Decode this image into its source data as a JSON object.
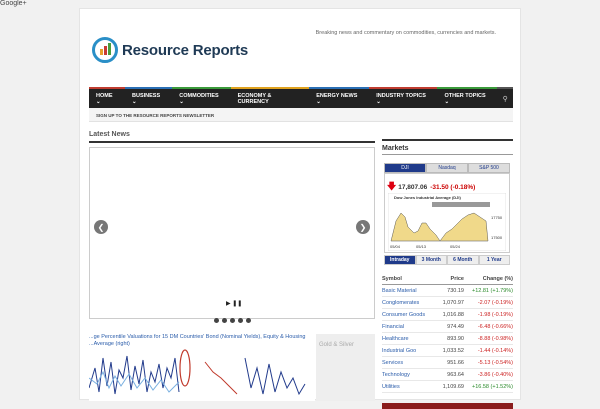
{
  "topbar": {
    "label": "Google+"
  },
  "header": {
    "brand": "Resource Reports",
    "tagline": "Breaking news and commentary on commodities, currencies and markets."
  },
  "nav": {
    "items": [
      {
        "label": "HOME ⌄",
        "color": "#c03d30"
      },
      {
        "label": "BUSINESS ⌄",
        "color": "#2a6fb5"
      },
      {
        "label": "COMMODITIES ⌄",
        "color": "#3a9a3a"
      },
      {
        "label": "ECONOMY & CURRENCY",
        "color": "#e0a21e"
      },
      {
        "label": "ENERGY NEWS ⌄",
        "color": "#2a6fb5"
      },
      {
        "label": "INDUSTRY TOPICS ⌄",
        "color": "#c03d30"
      },
      {
        "label": "OTHER TOPICS ⌄",
        "color": "#3a9a3a"
      }
    ],
    "search_icon": "search-icon"
  },
  "newsletter": {
    "label": "SIGN UP TO THE RESOURCE REPORTS NEWSLETTER"
  },
  "latest": {
    "title": "Latest News",
    "controls": "▶ ❚❚",
    "caption": "...ge Percentile Valuations for 15 DM Countries' Bond (Nominal Yields), Equity & Housing ...Average (right)"
  },
  "gold": {
    "title": "Gold & Silver"
  },
  "markets": {
    "title": "Markets",
    "tabs": [
      "DJI",
      "Nasdaq",
      "S&P 500"
    ],
    "quote": {
      "value": "17,807.06",
      "change": "-31.50 (-0.18%)"
    },
    "chart_label": "Dow Jones Industrial Average (DJI)",
    "ranges": [
      "Intraday",
      "3 Month",
      "6 Month",
      "1 Year"
    ],
    "sector_headers": [
      "Symbol",
      "Price",
      "Change (%)"
    ],
    "sectors": [
      {
        "name": "Basic Material",
        "price": "730.19",
        "change": "+12.81 (+1.79%)",
        "dir": "pos"
      },
      {
        "name": "Conglomerates",
        "price": "1,070.97",
        "change": "-2.07 (-0.19%)",
        "dir": "neg"
      },
      {
        "name": "Consumer Goods",
        "price": "1,016.88",
        "change": "-1.98 (-0.19%)",
        "dir": "neg"
      },
      {
        "name": "Financial",
        "price": "974.49",
        "change": "-6.48 (-0.66%)",
        "dir": "neg"
      },
      {
        "name": "Healthcare",
        "price": "893.90",
        "change": "-8.88 (-0.98%)",
        "dir": "neg"
      },
      {
        "name": "Industrial Goo",
        "price": "1,033.52",
        "change": "-1.44 (-0.14%)",
        "dir": "neg"
      },
      {
        "name": "Services",
        "price": "951.66",
        "change": "-5.13 (-0.54%)",
        "dir": "neg"
      },
      {
        "name": "Technology",
        "price": "963.64",
        "change": "-3.86 (-0.40%)",
        "dir": "neg"
      },
      {
        "name": "Utilities",
        "price": "1,109.69",
        "change": "+16.58 (+1.52%)",
        "dir": "pos"
      }
    ]
  }
}
